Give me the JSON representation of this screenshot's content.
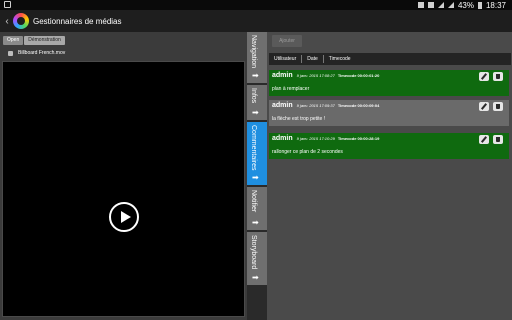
{
  "status_bar": {
    "battery": "43%",
    "time": "18:37",
    "icons": [
      "screenshot-icon",
      "bluetooth-icon",
      "mute-icon",
      "wifi-icon",
      "signal-icon",
      "battery-icon"
    ]
  },
  "app_bar": {
    "title": "Gestionnaires de médias",
    "back_icon": "chevron-left-icon",
    "logo_icon": "color-wheel-icon"
  },
  "breadcrumb": {
    "items": [
      "Open",
      "Démonstration"
    ]
  },
  "file": {
    "name": "Billboard French.mov",
    "icon": "file-icon"
  },
  "player": {
    "play_icon": "play-circle-icon"
  },
  "tabs": [
    {
      "label": "Navigation",
      "arrow": "➡",
      "active": false
    },
    {
      "label": "Infos",
      "arrow": "➡",
      "active": false
    },
    {
      "label": "Commentaires",
      "arrow": "➡",
      "active": true
    },
    {
      "label": "Notifier",
      "arrow": "➡",
      "active": false
    },
    {
      "label": "Storyboard",
      "arrow": "➡",
      "active": false
    }
  ],
  "comments_panel": {
    "add_label": "Ajouter",
    "columns": [
      "Utilisateur",
      "Date",
      "Timecode"
    ],
    "comments": [
      {
        "user": "admin",
        "date": "9 janv. 2015 17:08:27",
        "timecode": "Timecode 00:00:01:20",
        "text": "plan à remplacer",
        "color": "#0f6a0f"
      },
      {
        "user": "admin",
        "date": "9 janv. 2015 17:09:37",
        "timecode": "Timecode 00:00:09:04",
        "text": "la flèche est trop petite !",
        "color": "#6a6a6a"
      },
      {
        "user": "admin",
        "date": "9 janv. 2015 17:10:29",
        "timecode": "Timecode 00:00:28:19",
        "text": "rallonger ce plan de 2 secondes",
        "color": "#0f6a0f"
      }
    ]
  },
  "colors": {
    "accent": "#1f8fe0",
    "comment_green": "#0f6a0f",
    "comment_gray": "#6a6a6a"
  }
}
